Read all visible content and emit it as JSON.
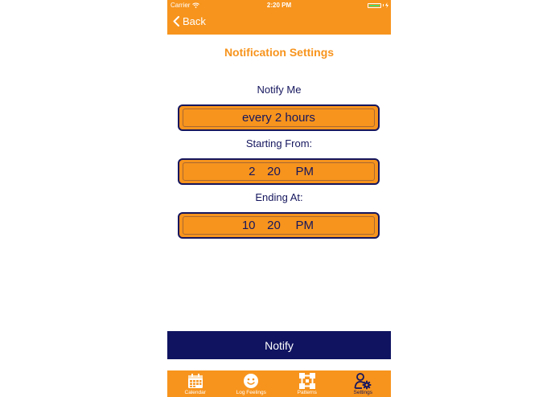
{
  "status_bar": {
    "carrier": "Carrier",
    "time": "2:20 PM"
  },
  "nav": {
    "back_label": "Back"
  },
  "page": {
    "title": "Notification Settings"
  },
  "notify_me": {
    "label": "Notify Me",
    "value": "every 2 hours"
  },
  "starting_from": {
    "label": "Starting From:",
    "hour": "2",
    "minute": "20",
    "ampm": "PM"
  },
  "ending_at": {
    "label": "Ending At:",
    "hour": "10",
    "minute": "20",
    "ampm": "PM"
  },
  "notify_button": {
    "label": "Notify"
  },
  "tab_bar": {
    "items": [
      {
        "label": "Calendar",
        "icon": "calendar-icon"
      },
      {
        "label": "Log Feelings",
        "icon": "smiley-icon"
      },
      {
        "label": "Patterns",
        "icon": "patterns-icon"
      },
      {
        "label": "Settings",
        "icon": "settings-icon",
        "selected": true
      }
    ]
  },
  "colors": {
    "accent": "#f7941d",
    "navy": "#15165e",
    "button": "#0f1360",
    "battery": "#4cd964"
  }
}
